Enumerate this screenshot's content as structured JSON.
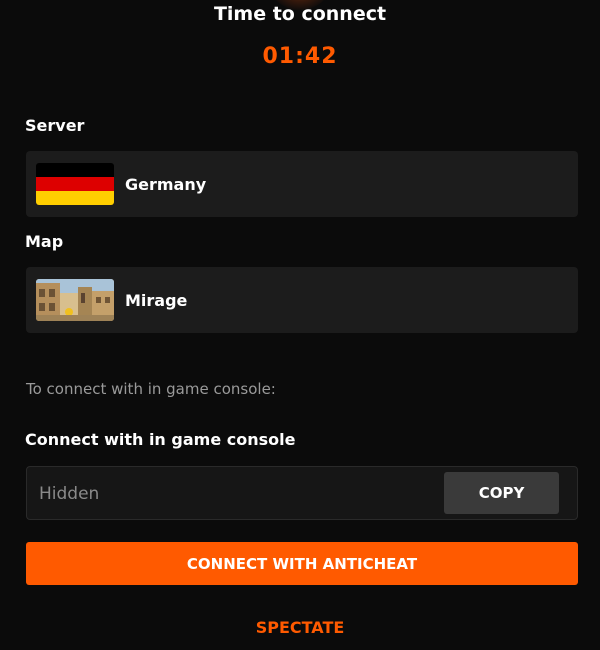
{
  "header": {
    "title": "Time to connect",
    "timer": "01:42"
  },
  "server": {
    "label": "Server",
    "name": "Germany",
    "icon": "flag-germany-icon"
  },
  "map": {
    "label": "Map",
    "name": "Mirage",
    "icon": "map-mirage-thumbnail"
  },
  "console": {
    "hint": "To connect with in game console:",
    "label": "Connect with in game console",
    "value": "",
    "placeholder": "Hidden",
    "copy_label": "COPY"
  },
  "actions": {
    "connect_label": "CONNECT WITH ANTICHEAT",
    "spectate_label": "SPECTATE"
  },
  "colors": {
    "accent": "#ff5a00",
    "background": "#0b0b0b",
    "card": "#1c1c1c",
    "copy_button": "#3a3a3a"
  }
}
